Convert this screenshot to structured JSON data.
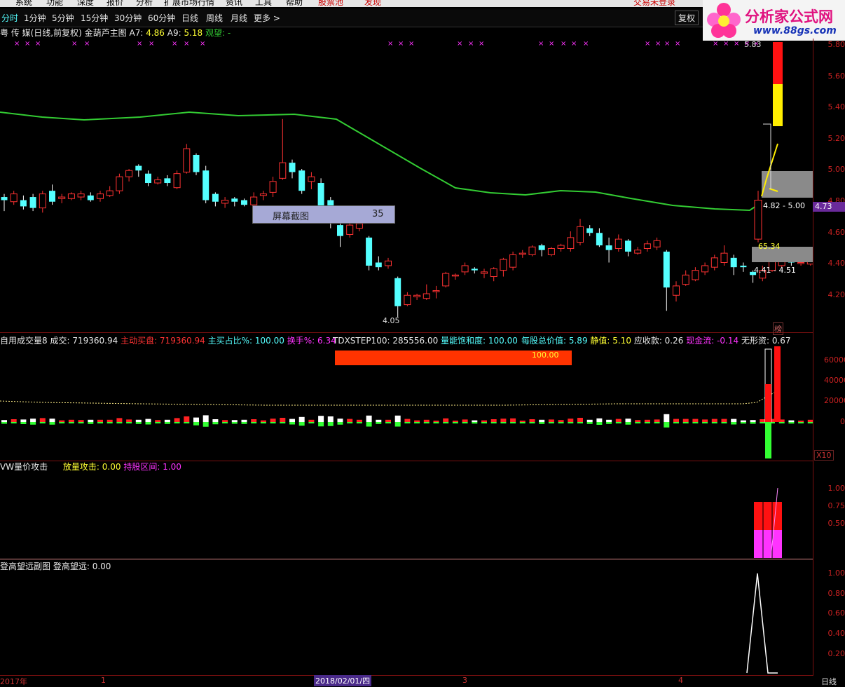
{
  "menu": [
    "系统",
    "功能",
    "深度",
    "报价",
    "分析",
    "扩展市场行情",
    "资讯",
    "工具",
    "帮助"
  ],
  "menu_right": [
    "股票池",
    "发现"
  ],
  "login_text": "交易未登录",
  "logo": {
    "title": "分析家公式网",
    "url": "www.88gs.com"
  },
  "periods": [
    "分时",
    "1分钟",
    "5分钟",
    "15分钟",
    "30分钟",
    "60分钟",
    "日线",
    "周线",
    "月线",
    "更多 >"
  ],
  "toolbar_right": {
    "fuquan": "复权"
  },
  "main_info": {
    "name": "粤 传 媒(日线,前复权)",
    "indicator": "金葫芦主图",
    "a7_label": "A7: ",
    "a7": "4.86",
    "a9_label": "A9: ",
    "a9": "5.18",
    "watch": "观望: -"
  },
  "price_axis": [
    "5.80",
    "5.60",
    "5.40",
    "5.20",
    "5.00",
    "4.80",
    "4.60",
    "4.40",
    "4.20"
  ],
  "price_badge": "4.73",
  "price_labels": {
    "high": "5.83",
    "low": "4.05",
    "range_box": "4.82 - 5.00",
    "range2": "4.41 - 4.51",
    "pct": "65.34",
    "bang": "榜"
  },
  "screenshot_tip": {
    "text": "屏幕截图",
    "num": "35"
  },
  "vol_info": {
    "l1": "自用成交量8",
    "l2": "成交: 719360.94",
    "l3": "主动买盘: 719360.94",
    "l4": "主买占比%: 100.00",
    "l5": "换手%: 6.34",
    "l6": "TDXSTEP100: 285556.00",
    "l7": "量能饱和度: 100.00",
    "l8": "每股总价值: 5.89",
    "l9": "静值: 5.10",
    "l10": "应收款: 0.26",
    "l11": "现金流: -0.14",
    "l12": "无形资: 0.67"
  },
  "vol_bar_label": "100.00",
  "vol_axis": [
    "60000",
    "40000",
    "20000",
    "0"
  ],
  "vol_x10": "X10",
  "attack_info": {
    "title": "VW量价攻击",
    "fang": "放量攻击: 0.00",
    "chi": "持股区间: 1.00"
  },
  "attack_axis": [
    "1.00",
    "0.75",
    "0.50"
  ],
  "dgw_info": {
    "title": "登高望远副图",
    "val": "登高望远: 0.00"
  },
  "dgw_axis": [
    "1.00",
    "0.80",
    "0.60",
    "0.40",
    "0.20"
  ],
  "time_axis": {
    "y2017": "2017年",
    "m1": "1",
    "cursor": "2018/02/01/四",
    "m3": "3",
    "m4": "4",
    "period": "日线"
  },
  "colors": {
    "up": "#ff3232",
    "down": "#54ffff",
    "ma": "#33cc33",
    "vol_down": "#33ff33",
    "magenta": "#ff33ff",
    "yellow": "#ffff00"
  }
}
